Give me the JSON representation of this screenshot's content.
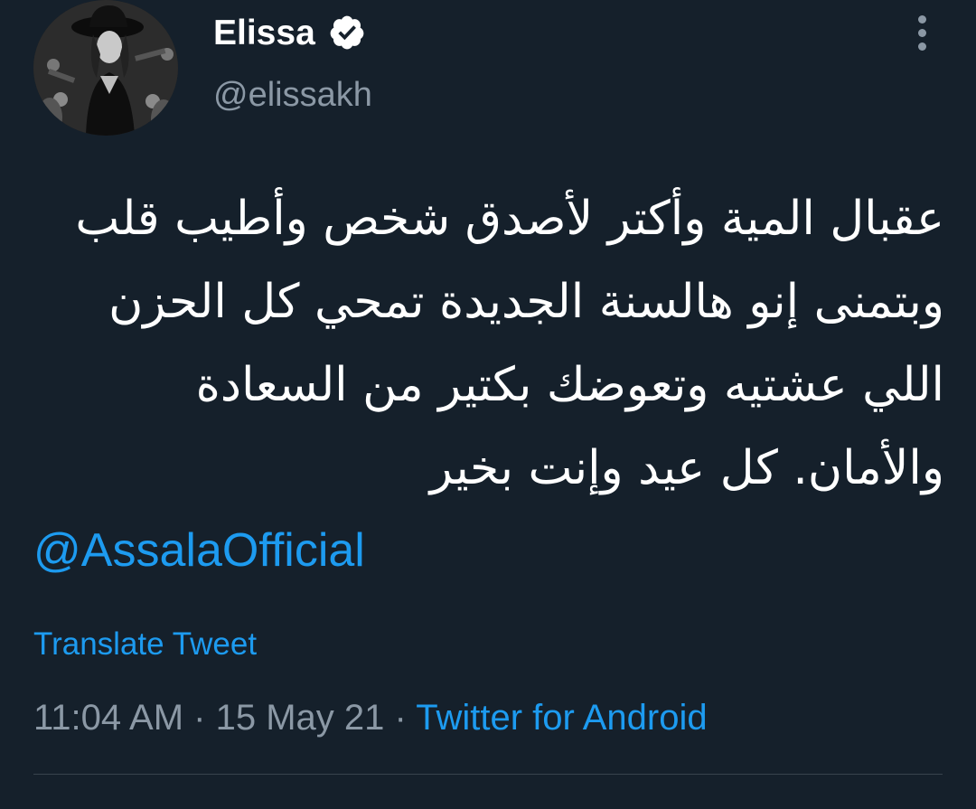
{
  "tweet": {
    "author": {
      "display_name": "Elissa",
      "handle": "@elissakh",
      "verified": true,
      "avatar_icon": "profile-photo"
    },
    "text": "عقبال المية وأكتر لأصدق شخص وأطيب قلب وبتمنى إنو هالسنة الجديدة تمحي كل الحزن اللي عشتيه وتعوضك بكتير من السعادة والأمان. كل عيد وإنت بخير",
    "mention": "@AssalaOfficial",
    "translate_label": "Translate Tweet",
    "time": "11:04 AM",
    "date": "15 May 21",
    "separator": "·",
    "source": "Twitter for Android"
  },
  "colors": {
    "background": "#15202b",
    "link": "#1d9bf0",
    "secondary_text": "#8b98a5",
    "divider": "#38444d"
  }
}
